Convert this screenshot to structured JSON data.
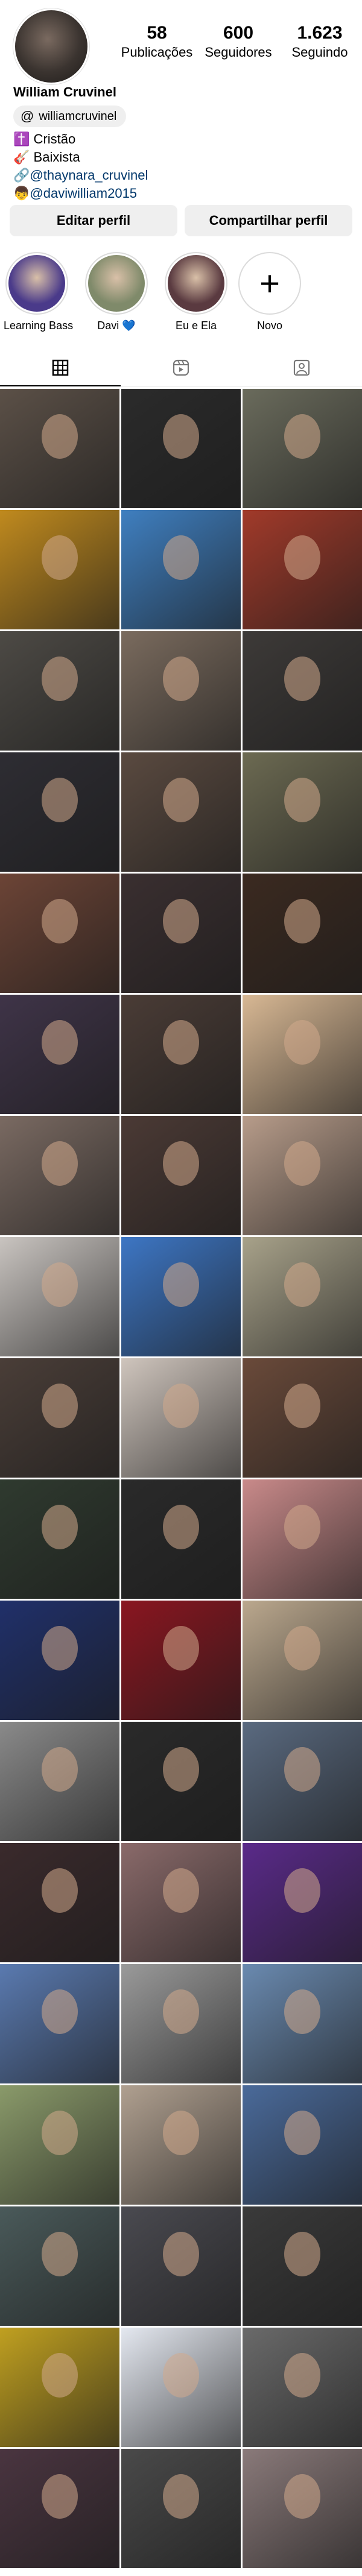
{
  "profile": {
    "name": "William Cruvinel",
    "threads_handle": "williamcruvinel",
    "bio": [
      {
        "emoji": "✝️",
        "text": "Cristão",
        "link": false
      },
      {
        "emoji": "🎸",
        "text": "Baixista",
        "link": false
      },
      {
        "emoji": "🔗",
        "text": "@thaynara_cruvinel",
        "link": true
      },
      {
        "emoji": "👦",
        "text": "@daviwilliam2015",
        "link": true
      }
    ]
  },
  "stats": [
    {
      "value": "58",
      "label": "Publicações"
    },
    {
      "value": "600",
      "label": "Seguidores"
    },
    {
      "value": "1.623",
      "label": "Seguindo"
    }
  ],
  "buttons": {
    "edit": "Editar perfil",
    "share": "Compartilhar perfil"
  },
  "highlights": [
    {
      "label": "Learning Bass",
      "color": "#4a3a8a"
    },
    {
      "label": "Davi 💙",
      "color": "#7f8a6a"
    },
    {
      "label": "Eu e Ela",
      "color": "#5a3a40"
    },
    {
      "label": "Novo",
      "color": "#ffffff"
    }
  ],
  "tabs": [
    "grid-icon",
    "reels-icon",
    "tagged-icon"
  ],
  "grid_colors": [
    "#5b5047",
    "#2b2b2b",
    "#6a6b5c",
    "#c08a1e",
    "#3f7fc0",
    "#a13a2a",
    "#4d4a45",
    "#7a6b5e",
    "#3d3a38",
    "#2e2d33",
    "#5a4a40",
    "#6c6a52",
    "#6c4436",
    "#3a2f30",
    "#3b2a20",
    "#3f3448",
    "#4a3c36",
    "#d8b894",
    "#7a6a62",
    "#4b3a35",
    "#b79c8a",
    "#c9c4c0",
    "#3d76c4",
    "#a8a28a",
    "#4a3e38",
    "#cfc5bd",
    "#6a4a3a",
    "#2f3a2f",
    "#2a2a2a",
    "#c98a8a",
    "#20306a",
    "#8a1620",
    "#bba88e",
    "#8a8a8a",
    "#2a2a2a",
    "#5a6a80",
    "#3a2a2c",
    "#8a6a6a",
    "#5a2a8a",
    "#5a7ab0",
    "#9a9a9a",
    "#6a8ab0",
    "#8a9a6a",
    "#b0a090",
    "#4a6a9a",
    "#4a5a5a",
    "#4a4a50",
    "#3a3a3a",
    "#c0a020",
    "#e4e8f0",
    "#6a6a6a",
    "#4a3540",
    "#4a4a4a",
    "#8a7a7a"
  ]
}
